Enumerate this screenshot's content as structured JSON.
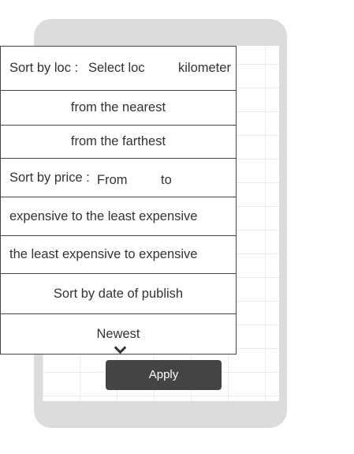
{
  "sort_location": {
    "label": "Sort by loc :",
    "select_placeholder": "Select loc",
    "unit": "kilometer"
  },
  "location_options": [
    "from the nearest",
    "from the farthest"
  ],
  "sort_price": {
    "label": "Sort by price :",
    "from_placeholder": "From",
    "to_label": "to"
  },
  "price_options": [
    "expensive to the least expensive",
    "the least expensive to expensive"
  ],
  "sort_date": {
    "label": "Sort by date of publish",
    "selected": "Newest"
  },
  "apply_label": "Apply",
  "colors": {
    "phone_frame": "#dcdcdc",
    "button": "#444444",
    "border": "#444444",
    "text": "#333333"
  }
}
